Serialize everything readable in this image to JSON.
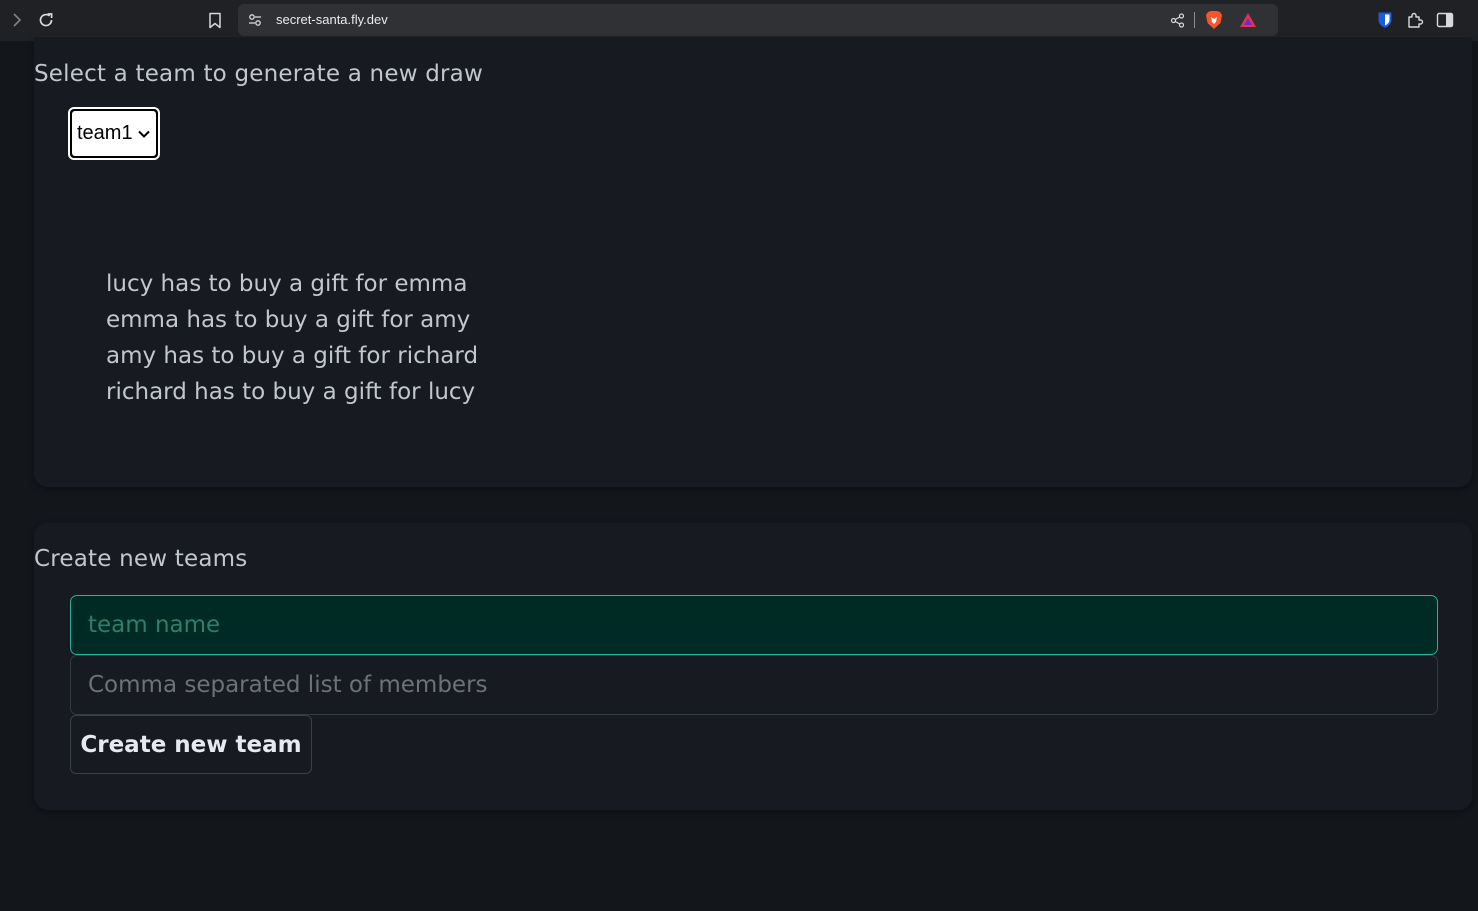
{
  "browser": {
    "url": "secret-santa.fly.dev",
    "icons": [
      "forward-icon",
      "reload-icon",
      "bookmark-icon",
      "site-info-icon",
      "share-icon",
      "brave-shields-icon",
      "brave-rewards-icon",
      "bitwarden-icon",
      "extensions-icon",
      "sidebar-toggle-icon"
    ]
  },
  "draw": {
    "title": "Select a team to generate a new draw",
    "selected_team": "team1",
    "results": [
      "lucy has to buy a gift for emma",
      "emma has to buy a gift for amy",
      "amy has to buy a gift for richard",
      "richard has to buy a gift for lucy"
    ]
  },
  "create": {
    "title": "Create new teams",
    "team_name_placeholder": "team name",
    "members_placeholder": "Comma separated list of members",
    "button_label": "Create new team"
  },
  "colors": {
    "page_background": "#13161b",
    "card_background": "#171a20",
    "text": "#c2c6cd",
    "focus_accent": "#21b59a",
    "focus_fill": "#002a24"
  }
}
